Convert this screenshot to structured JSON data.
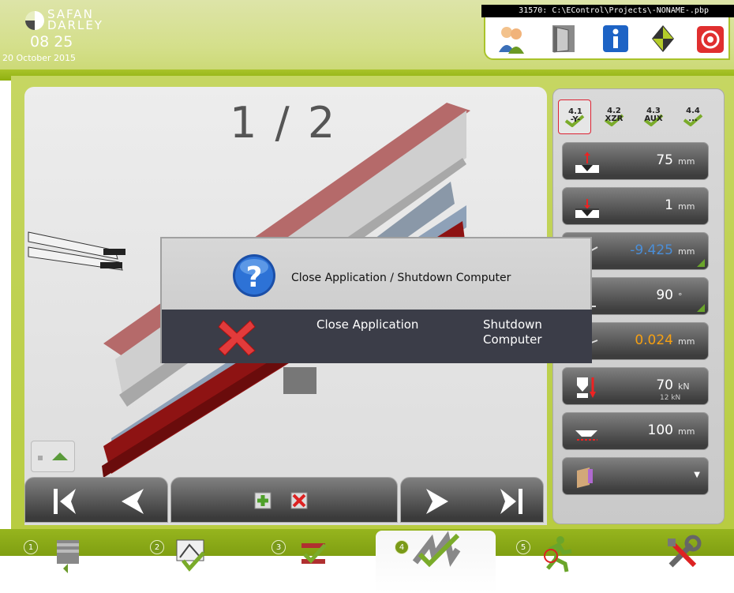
{
  "header": {
    "brand_line1": "SAFAN",
    "brand_line2": "DARLEY",
    "time": "08 25",
    "date": "20 October 2015",
    "project_path": "31570: C:\\EControl\\Projects\\-NONAME-.pbp",
    "toolbar_icons": [
      "users-icon",
      "door-icon",
      "info-icon",
      "logo-icon",
      "shutdown-icon"
    ]
  },
  "canvas": {
    "step": "1 / 2"
  },
  "axis_tabs": [
    {
      "label": "4.1\n-Y-",
      "active": true
    },
    {
      "label": "4.2\nXZR",
      "active": false
    },
    {
      "label": "4.3\nAUX",
      "active": false
    },
    {
      "label": "4.4\n...",
      "active": false
    }
  ],
  "rows": [
    {
      "icon": "opening-icon",
      "value": "75",
      "unit": "mm",
      "value_color": "#ffffff"
    },
    {
      "icon": "closing-icon",
      "value": "1",
      "unit": "mm",
      "value_color": "#ffffff"
    },
    {
      "icon": "position-icon",
      "value": "-9.425",
      "unit": "mm",
      "value_color": "#4a8ed8"
    },
    {
      "icon": "angle-icon",
      "value": "90",
      "unit": "°",
      "value_color": "#ffffff"
    },
    {
      "icon": "correction-icon",
      "value": "0.024",
      "unit": "mm",
      "value_color": "#f6a012"
    },
    {
      "icon": "force-icon",
      "value": "70",
      "unit": "kN",
      "sub": "12  kN",
      "value_color": "#ffffff"
    },
    {
      "icon": "width-icon",
      "value": "100",
      "unit": "mm",
      "value_color": "#ffffff"
    },
    {
      "icon": "material-icon",
      "value": "",
      "unit": "",
      "value_color": "#ffffff"
    }
  ],
  "dialog": {
    "title": "Close Application / Shutdown Computer",
    "close_app": "Close Application",
    "shutdown_line1": "Shutdown",
    "shutdown_line2": "Computer"
  },
  "steps": [
    {
      "num": "1",
      "icon": "tools-list-icon"
    },
    {
      "num": "2",
      "icon": "product-check-icon"
    },
    {
      "num": "3",
      "icon": "bend-sequence-icon"
    },
    {
      "num": "4",
      "icon": "bend-program-icon"
    },
    {
      "num": "5",
      "icon": "run-icon"
    },
    {
      "num": "",
      "icon": "settings-icon"
    }
  ]
}
